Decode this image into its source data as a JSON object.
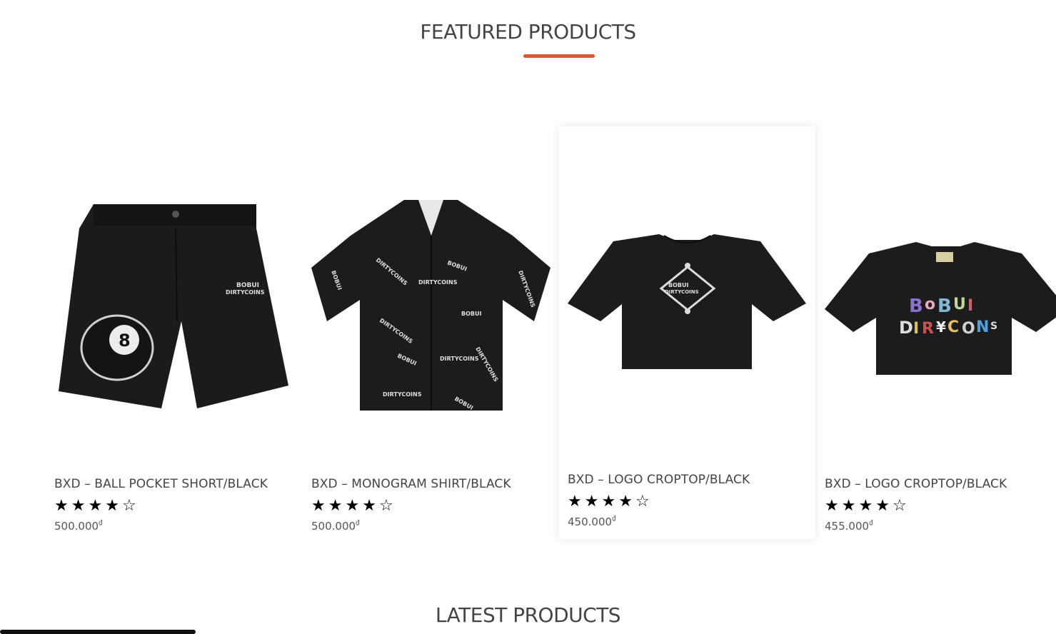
{
  "featured": {
    "title": "FEATURED PRODUCTS"
  },
  "latest": {
    "title": "LATEST PRODUCTS"
  },
  "products": [
    {
      "name": "BXD – BALL POCKET SHORT/BLACK",
      "rating": 4,
      "price": "500.000",
      "currency": "₫",
      "image": "ball-pocket-short-image"
    },
    {
      "name": "BXD – MONOGRAM SHIRT/BLACK",
      "rating": 4,
      "price": "500.000",
      "currency": "₫",
      "image": "monogram-shirt-image"
    },
    {
      "name": "BXD – LOGO CROPTOP/BLACK",
      "rating": 4,
      "price": "450.000",
      "currency": "₫",
      "image": "logo-croptop-image"
    },
    {
      "name": "BXD – LOGO CROPTOP/BLACK",
      "rating": 4,
      "price": "455.000",
      "currency": "₫",
      "image": "logo-croptop-color-image"
    }
  ],
  "colors": {
    "accent": "#e2533a",
    "text": "#444444",
    "star": "#000000"
  }
}
